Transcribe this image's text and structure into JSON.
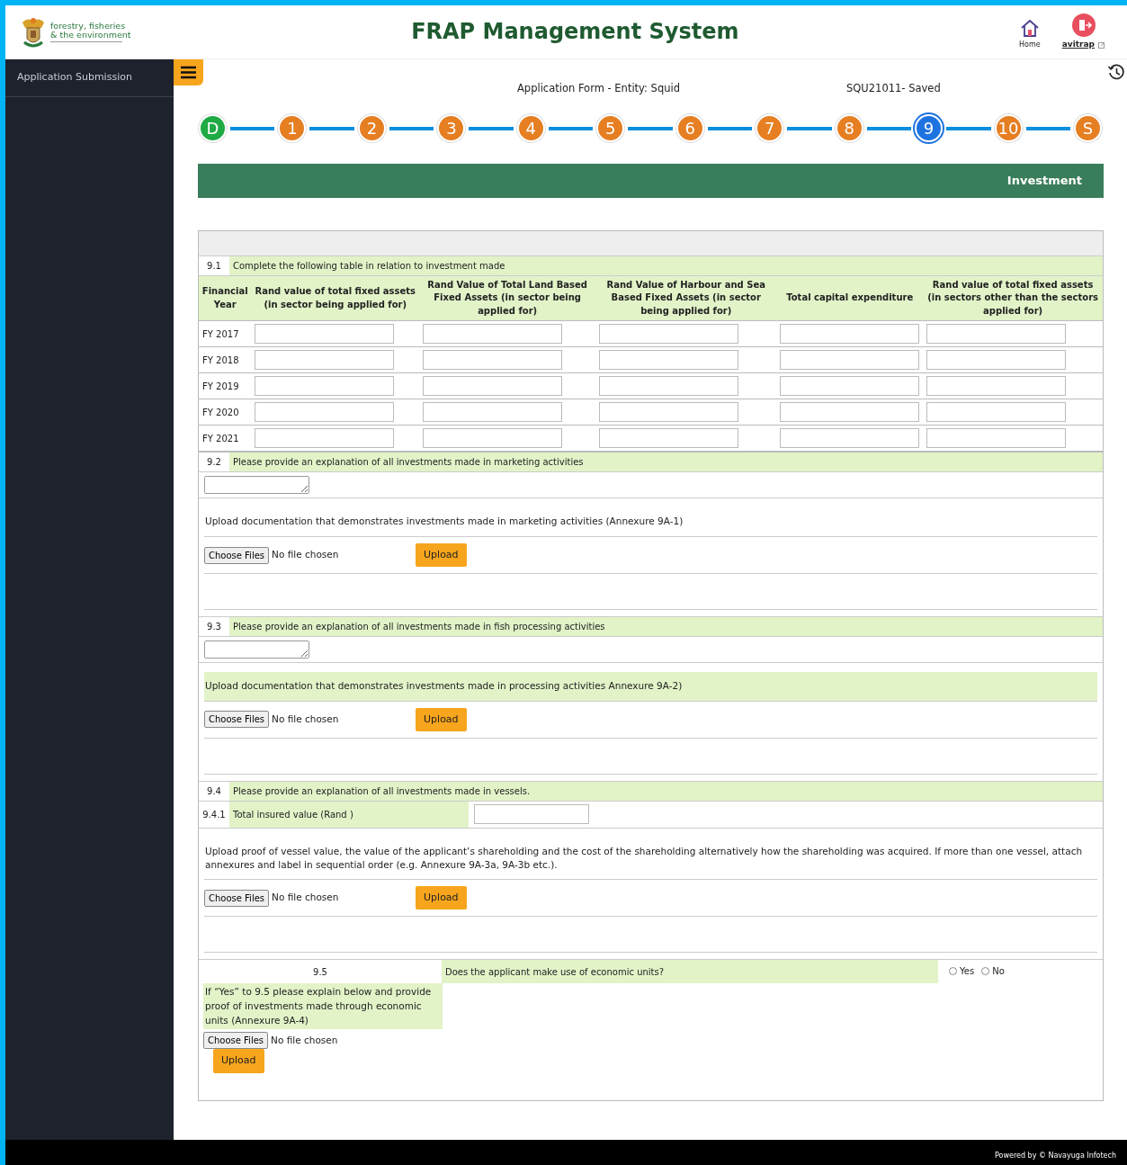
{
  "header": {
    "logo_lines": [
      "forestry, fisheries",
      "& the environment"
    ],
    "title": "FRAP Management System",
    "home": "Home",
    "user": "avitrap"
  },
  "sidebar": {
    "items": [
      {
        "label": "Application Submission",
        "selected": false
      }
    ]
  },
  "form_info": {
    "entity": "Application Form - Entity: Squid",
    "status": "SQU21011- Saved"
  },
  "steps": [
    {
      "label": "D",
      "color": "#1faa45",
      "selected": false
    },
    {
      "label": "1",
      "color": "#e67e22",
      "selected": false
    },
    {
      "label": "2",
      "color": "#e67e22",
      "selected": false
    },
    {
      "label": "3",
      "color": "#e67e22",
      "selected": false
    },
    {
      "label": "4",
      "color": "#e67e22",
      "selected": false
    },
    {
      "label": "5",
      "color": "#e67e22",
      "selected": false
    },
    {
      "label": "6",
      "color": "#e67e22",
      "selected": false
    },
    {
      "label": "7",
      "color": "#e67e22",
      "selected": false
    },
    {
      "label": "8",
      "color": "#e67e22",
      "selected": false
    },
    {
      "label": "9",
      "color": "#1e73e0",
      "selected": true
    },
    {
      "label": "10",
      "color": "#e67e22",
      "selected": false
    },
    {
      "label": "S",
      "color": "#e67e22",
      "selected": false
    }
  ],
  "section_title": "Investment",
  "sections": [
    {
      "kind": "table",
      "number": "9.1",
      "text": "Complete the following table in relation to investment made",
      "columns": [
        "Financial Year",
        "Rand value of total fixed assets (in sector being applied for)",
        "Rand Value of Total Land Based Fixed Assets (in sector being applied for)",
        "Rand Value of Harbour and Sea Based Fixed Assets (in sector being applied for)",
        "Total capital expenditure",
        "Rand value of total fixed assets (in sectors other than the sectors applied for)"
      ],
      "rows": [
        {
          "year": "FY 2017"
        },
        {
          "year": "FY 2018"
        },
        {
          "year": "FY 2019"
        },
        {
          "year": "FY 2020"
        },
        {
          "year": "FY 2021"
        }
      ]
    },
    {
      "kind": "explain",
      "number": "9.2",
      "text": "Please provide an explanation of all investments made in marketing activities",
      "upload_label": "Upload documentation that demonstrates investments made in marketing activities (Annexure 9A-1)",
      "highlighted": false,
      "file_button": "Choose Files",
      "file_status": "No file chosen",
      "upload": "Upload"
    },
    {
      "kind": "explain",
      "number": "9.3",
      "text": "Please provide an explanation of all investments made in fish processing activities",
      "upload_label": "Upload documentation that demonstrates investments made in processing activities Annexure 9A-2)",
      "highlighted": true,
      "file_button": "Choose Files",
      "file_status": "No file chosen",
      "upload": "Upload"
    },
    {
      "kind": "vessel",
      "number": "9.4",
      "text": "Please provide an explanation of all investments made in vessels.",
      "sub_number": "9.4.1",
      "sub_label": "Total insured value (Rand )",
      "upload_label": "Upload proof of vessel value, the value of the applicant’s shareholding and the cost of the shareholding alternatively how the shareholding was acquired. If more than one vessel, attach annexures and label in sequential order (e.g. Annexure 9A-3a, 9A-3b etc.).",
      "file_button": "Choose Files",
      "file_status": "No file chosen",
      "upload": "Upload"
    },
    {
      "kind": "economic",
      "number": "9.5",
      "text": "Does the applicant make use of economic units?",
      "options": [
        {
          "label": "Yes",
          "selected": false
        },
        {
          "label": "No",
          "selected": false
        }
      ],
      "explain": "If “Yes” to 9.5 please explain below and provide proof of investments made through economic units (Annexure 9A-4)",
      "file_button": "Choose Files",
      "file_status": "No file chosen",
      "upload": "Upload"
    }
  ],
  "footer": "Powered by © Navayuga Infotech"
}
